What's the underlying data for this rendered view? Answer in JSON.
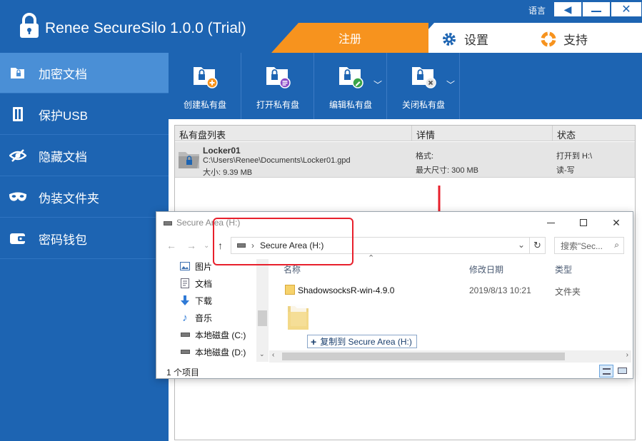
{
  "app": {
    "title": "Renee SecureSilo 1.0.0 (Trial)",
    "lang_label": "语言",
    "tabs": {
      "register": "注册",
      "settings": "设置",
      "support": "支持"
    }
  },
  "sidebar": {
    "items": [
      {
        "label": "加密文档",
        "icon": "folder-lock-icon",
        "active": true
      },
      {
        "label": "保护USB",
        "icon": "usb-icon",
        "active": false
      },
      {
        "label": "隐藏文档",
        "icon": "eye-slash-icon",
        "active": false
      },
      {
        "label": "伪装文件夹",
        "icon": "mask-icon",
        "active": false
      },
      {
        "label": "密码钱包",
        "icon": "wallet-icon",
        "active": false
      }
    ]
  },
  "toolbar": {
    "buttons": [
      {
        "label": "创建私有盘",
        "icon": "create-disk-icon",
        "has_caret": false
      },
      {
        "label": "打开私有盘",
        "icon": "open-disk-icon",
        "has_caret": false
      },
      {
        "label": "编辑私有盘",
        "icon": "edit-disk-icon",
        "has_caret": true
      },
      {
        "label": "关闭私有盘",
        "icon": "close-disk-icon",
        "has_caret": true
      }
    ]
  },
  "list": {
    "headers": {
      "name": "私有盘列表",
      "detail": "详情",
      "status": "状态"
    },
    "rows": [
      {
        "name": "Locker01",
        "path": "C:\\Users\\Renee\\Documents\\Locker01.gpd",
        "size": "大小: 9.39 MB",
        "format": "格式:",
        "max_size": "最大尺寸: 300 MB",
        "status1": "打开到 H:\\",
        "status2": "读-写"
      }
    ]
  },
  "explorer": {
    "title": "Secure Area (H:)",
    "address_chevron": "›",
    "address": "Secure Area (H:)",
    "search_placeholder": "搜索\"Sec...",
    "nav": [
      {
        "label": "图片",
        "icon": "pictures-icon"
      },
      {
        "label": "文档",
        "icon": "documents-icon"
      },
      {
        "label": "下载",
        "icon": "download-icon"
      },
      {
        "label": "音乐",
        "icon": "music-icon"
      },
      {
        "label": "本地磁盘 (C:)",
        "icon": "drive-icon"
      },
      {
        "label": "本地磁盘 (D:)",
        "icon": "drive-icon"
      }
    ],
    "columns": {
      "name": "名称",
      "modified": "修改日期",
      "type": "类型"
    },
    "files": [
      {
        "name": "ShadowsocksR-win-4.9.0",
        "modified": "2019/8/13 10:21",
        "type": "文件夹"
      }
    ],
    "drag_tooltip": "复制到 Secure Area (H:)",
    "status": "1 个项目"
  },
  "colors": {
    "brand_blue": "#1d64b2",
    "active_sidebar": "#4a8fd6",
    "register_orange": "#f7931e",
    "highlight_red": "#e8202c"
  }
}
